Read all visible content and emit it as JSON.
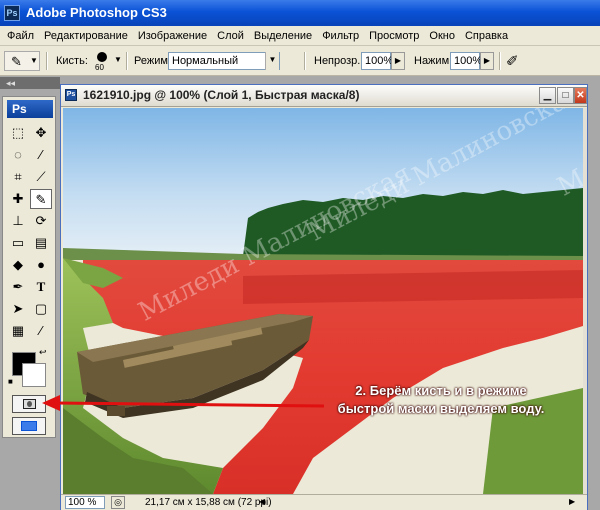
{
  "app": {
    "title": "Adobe Photoshop CS3",
    "logo": "Ps"
  },
  "menu": [
    "Файл",
    "Редактирование",
    "Изображение",
    "Слой",
    "Выделение",
    "Фильтр",
    "Просмотр",
    "Окно",
    "Справка"
  ],
  "options": {
    "brush_label": "Кисть:",
    "brush_size": "60",
    "mode_label": "Режим:",
    "mode_value": "Нормальный",
    "opacity_label": "Непрозр.:",
    "opacity_value": "100%",
    "flow_label": "Нажим:",
    "flow_value": "100%"
  },
  "toolbox": {
    "logo": "Ps"
  },
  "document": {
    "title": "1621910.jpg @ 100% (Слой 1, Быстрая маска/8)",
    "zoom": "100 %",
    "size_info": "21,17 cм x 15,88 cм (72 ppi)"
  },
  "annotation": {
    "line1": "2. Берём кисть и в режиме",
    "line2": "быстрой маски выделяем воду."
  },
  "watermark": {
    "text1": "Миледи Малиновская",
    "text2": "М"
  },
  "colors": {
    "titlebar": "#0a52d6",
    "mask_red": "#e63030",
    "arrow": "#e01010",
    "sky": "#bcd8f0",
    "forest": "#1f5a24"
  }
}
